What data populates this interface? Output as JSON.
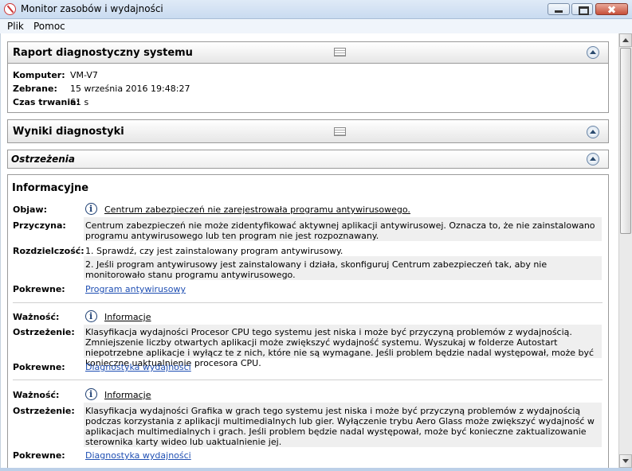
{
  "window": {
    "title": "Monitor zasobów i wydajności"
  },
  "menu": [
    "Plik",
    "Pomoc"
  ],
  "report": {
    "title": "Raport diagnostyczny systemu",
    "fields": [
      {
        "label": "Komputer:",
        "value": "VM-V7"
      },
      {
        "label": "Zebrane:",
        "value": "15 września 2016 19:48:27"
      },
      {
        "label": "Czas trwania:",
        "value": "61 s"
      }
    ]
  },
  "results": {
    "title": "Wyniki diagnostyki"
  },
  "warnings": {
    "title": "Ostrzeżenia"
  },
  "info": {
    "title": "Informacyjne",
    "item1": {
      "symptom_label": "Objaw:",
      "symptom": "Centrum zabezpieczeń nie zarejestrowała programu antywirusowego.",
      "cause_label": "Przyczyna:",
      "cause": "Centrum zabezpieczeń nie może zidentyfikować aktywnej aplikacji antywirusowej. Oznacza to, że nie zainstalowano programu antywirusowego lub ten program nie jest rozpoznawany.",
      "resolution_label": "Rozdzielczość:",
      "resolution1": "1. Sprawdź, czy jest zainstalowany program antywirusowy.",
      "resolution2": "2. Jeśli program antywirusowy jest zainstalowany i działa, skonfiguruj Centrum zabezpieczeń tak, aby nie monitorowało stanu programu antywirusowego.",
      "related_label": "Pokrewne:",
      "related": "Program antywirusowy"
    },
    "item2": {
      "severity_label": "Ważność:",
      "severity": "Informacje",
      "warning_label": "Ostrzeżenie:",
      "warning": "Klasyfikacja wydajności Procesor CPU tego systemu jest niska i może być przyczyną problemów z wydajnością. Zmniejszenie liczby otwartych aplikacji może zwiększyć wydajność systemu. Wyszukaj w folderze Autostart niepotrzebne aplikacje i wyłącz te z nich, które nie są wymagane. Jeśli problem będzie nadal występował, może być konieczne uaktualnienie procesora CPU.",
      "related_label": "Pokrewne:",
      "related": "Diagnostyka wydajności"
    },
    "item3": {
      "severity_label": "Ważność:",
      "severity": "Informacje",
      "warning_label": "Ostrzeżenie:",
      "warning": "Klasyfikacja wydajności Grafika w grach tego systemu jest niska i może być przyczyną problemów z wydajnością podczas korzystania z aplikacji multimedialnych lub gier. Wyłączenie trybu Aero Glass może zwiększyć wydajność w aplikacjach multimedialnych i grach. Jeśli problem będzie nadal występował, może być konieczne zaktualizowanie sterownika karty wideo lub uaktualnienie jej.",
      "related_label": "Pokrewne:",
      "related": "Diagnostyka wydajności"
    }
  }
}
